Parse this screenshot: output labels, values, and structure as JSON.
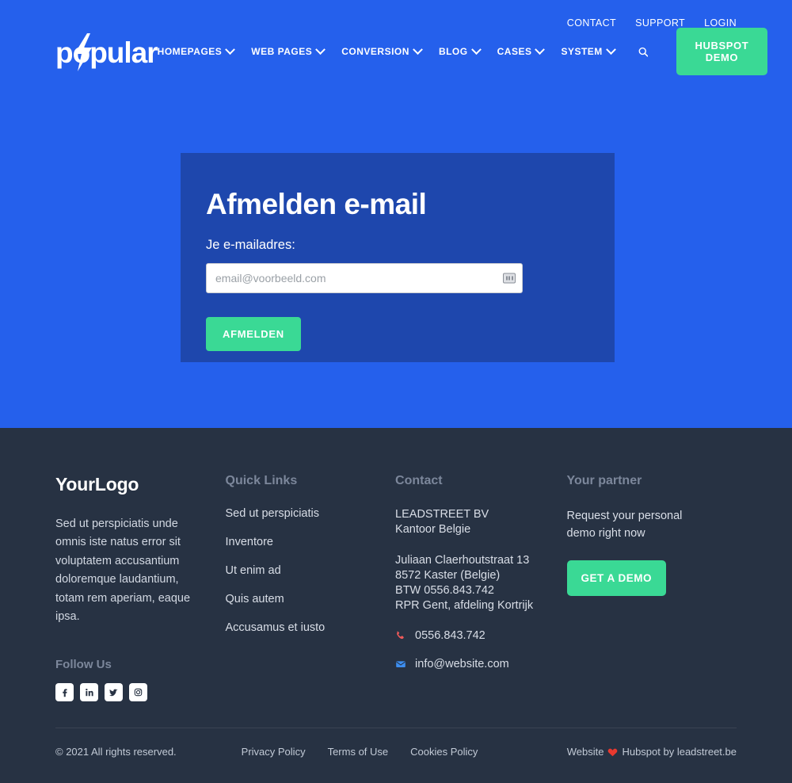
{
  "colors": {
    "page_blue": "#2560ec",
    "card_blue": "#1e47ad",
    "accent_green": "#3ad995",
    "footer_dark": "#273243",
    "muted_heading": "#7c879b"
  },
  "header": {
    "logo_text": "popular",
    "logo_icon": "lightning-bolt-icon",
    "top_links": [
      {
        "label": "CONTACT"
      },
      {
        "label": "SUPPORT"
      },
      {
        "label": "LOGIN"
      }
    ],
    "nav_items": [
      {
        "label": "HOMEPAGES",
        "has_dropdown": true
      },
      {
        "label": "WEB PAGES",
        "has_dropdown": true
      },
      {
        "label": "CONVERSION",
        "has_dropdown": true
      },
      {
        "label": "BLOG",
        "has_dropdown": true
      },
      {
        "label": "CASES",
        "has_dropdown": true
      },
      {
        "label": "SYSTEM",
        "has_dropdown": true
      }
    ],
    "search_icon": "search-icon",
    "cta_label": "HUBSPOT DEMO"
  },
  "card": {
    "title": "Afmelden e-mail",
    "field_label": "Je e-mailadres:",
    "email_placeholder": "email@voorbeeld.com",
    "email_value": "",
    "autofill_icon": "autofill-icon",
    "submit_label": "AFMELDEN"
  },
  "footer": {
    "brand": {
      "name": "YourLogo",
      "description": "Sed ut perspiciatis unde omnis iste natus error sit voluptatem accusantium doloremque laudantium, totam rem aperiam, eaque ipsa."
    },
    "follow": {
      "title": "Follow Us",
      "socials": [
        {
          "name": "facebook-icon",
          "glyph": "f"
        },
        {
          "name": "linkedin-icon",
          "glyph": "in"
        },
        {
          "name": "twitter-icon",
          "glyph": "bird"
        },
        {
          "name": "instagram-icon",
          "glyph": "camera"
        }
      ]
    },
    "quick_links": {
      "title": "Quick Links",
      "items": [
        {
          "label": "Sed ut perspiciatis"
        },
        {
          "label": "Inventore"
        },
        {
          "label": "Ut enim ad"
        },
        {
          "label": "Quis autem"
        },
        {
          "label": "Accusamus et iusto"
        }
      ]
    },
    "contact": {
      "title": "Contact",
      "company_line1": "LEADSTREET BV",
      "company_line2": "Kantoor Belgie",
      "address_line1": "Juliaan Claerhoutstraat 13",
      "address_line2": "8572 Kaster (Belgie)",
      "address_line3": "BTW 0556.843.742",
      "address_line4": "RPR Gent, afdeling Kortrijk",
      "phone": "0556.843.742",
      "phone_icon": "phone-icon",
      "email": "info@website.com",
      "email_icon": "envelope-icon"
    },
    "partner": {
      "title": "Your partner",
      "text": "Request your personal demo right now",
      "cta_label": "GET A DEMO"
    },
    "bottom": {
      "copyright": "© 2021 All rights reserved.",
      "legal": [
        {
          "label": "Privacy Policy"
        },
        {
          "label": "Terms of Use"
        },
        {
          "label": "Cookies Policy"
        }
      ],
      "credit_prefix": "Website",
      "credit_icon": "heart-icon",
      "credit_suffix": "Hubspot by leadstreet.be"
    }
  }
}
